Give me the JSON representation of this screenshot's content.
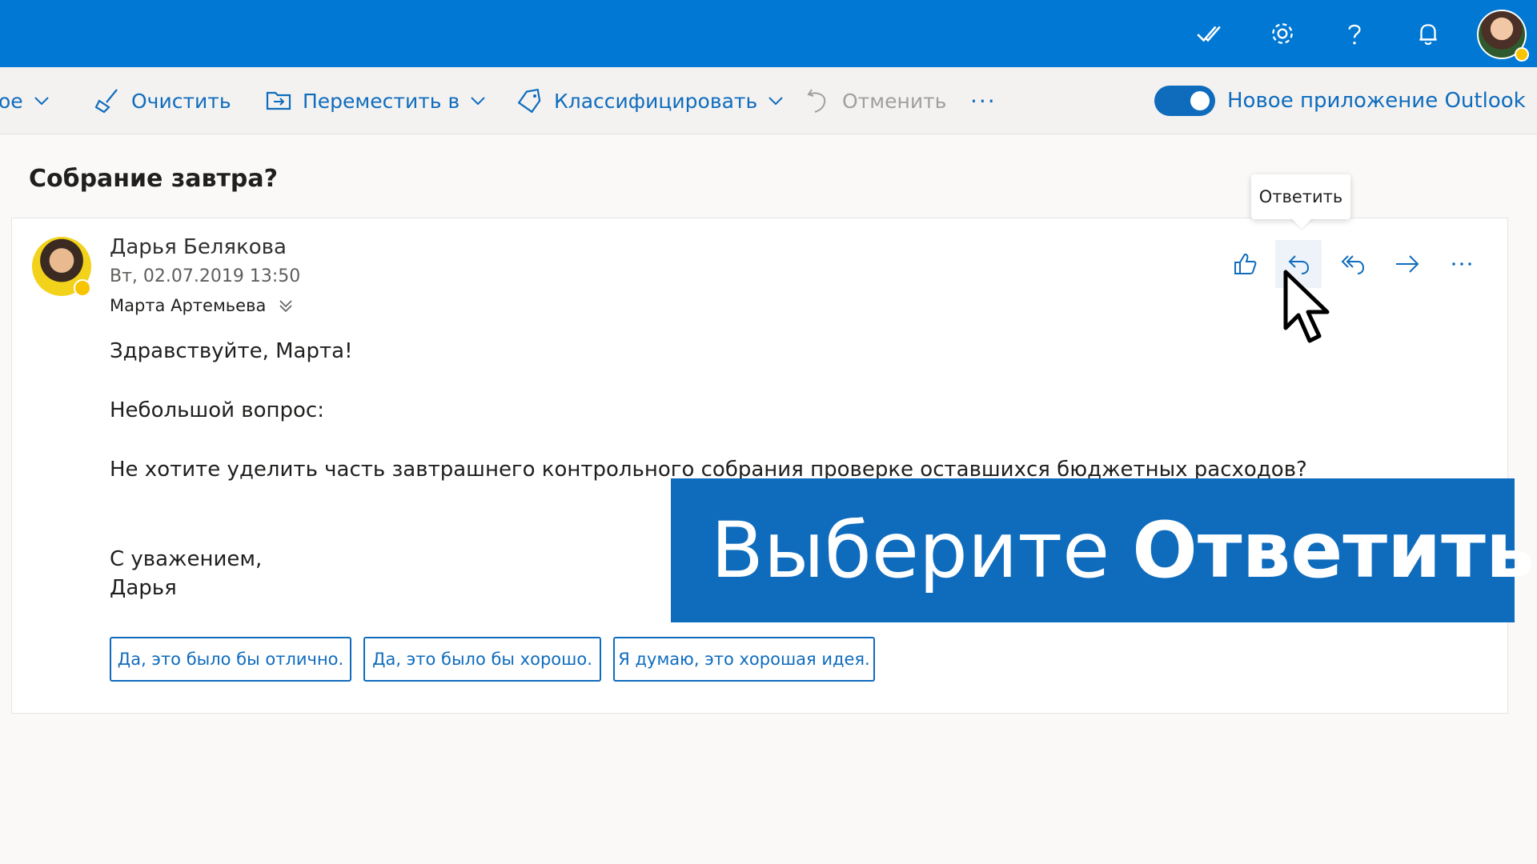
{
  "colors": {
    "accent": "#0078d4",
    "link": "#0f6cbd",
    "status": "#f8c400"
  },
  "topbar": {
    "icons": [
      "checkmark-icon",
      "gear-icon",
      "help-icon",
      "bell-icon",
      "user-avatar"
    ]
  },
  "commandbar": {
    "partial_label": "ое",
    "clean_label": "Очистить",
    "move_label": "Переместить в",
    "categorize_label": "Классифицировать",
    "undo_label": "Отменить",
    "more_label": "···",
    "new_outlook_label": "Новое приложение Outlook",
    "new_outlook_on": true
  },
  "email": {
    "subject": "Собрание завтра?",
    "sender": "Дарья Белякова",
    "date": "Вт, 02.07.2019 13:50",
    "recipient": "Марта Артемьева",
    "tooltip": "Ответить",
    "body": {
      "greeting": "Здравствуйте, Марта!",
      "line1": "Небольшой вопрос:",
      "line2": "Не хотите уделить часть завтрашнего контрольного собрания проверке оставшихся бюджетных расходов?",
      "signoff": "С уважением,",
      "signature": "Дарья"
    },
    "suggested_replies": [
      "Да, это было бы отлично.",
      "Да, это было бы хорошо.",
      "Я думаю, это хорошая идея."
    ]
  },
  "overlay": {
    "regular": "Выберите",
    "bold": "Ответить"
  }
}
